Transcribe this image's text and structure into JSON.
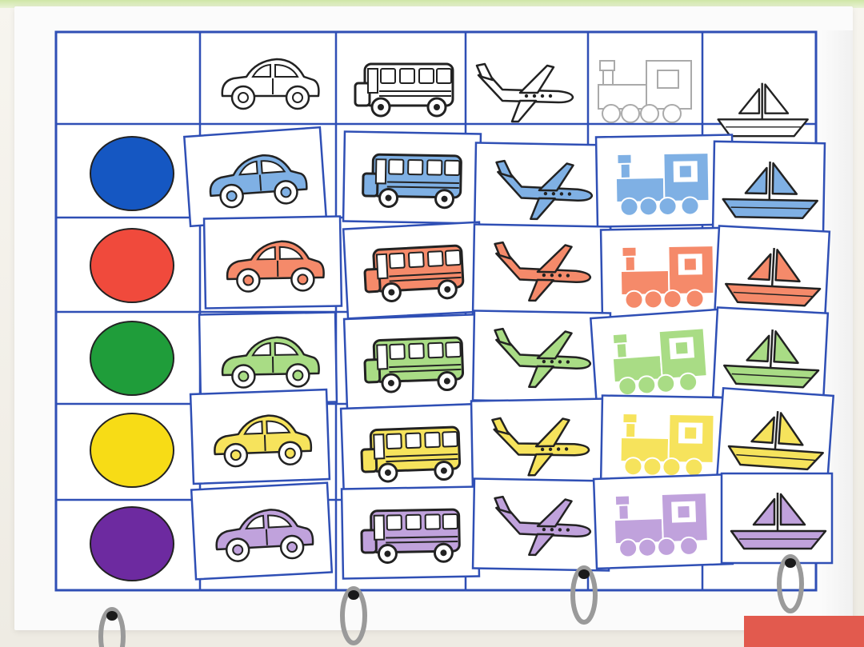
{
  "scene": {
    "description_kind": "binder-page-color-sorting-activity"
  },
  "colors": {
    "grid_line": "#2f4fb5",
    "blue": "#1557c2",
    "red": "#f04a3c",
    "green": "#1f9d3a",
    "yellow": "#f7dc16",
    "purple": "#6d2aa0",
    "blue_light": "#7fb0e4",
    "red_light": "#f58a6a",
    "green_light": "#a9dc85",
    "yellow_light": "#f6e35c",
    "purple_light": "#c0a2dc"
  },
  "columns": [
    "car",
    "bus",
    "airplane",
    "train",
    "sailboat"
  ],
  "rows": [
    "blue",
    "red",
    "green",
    "yellow",
    "purple"
  ]
}
